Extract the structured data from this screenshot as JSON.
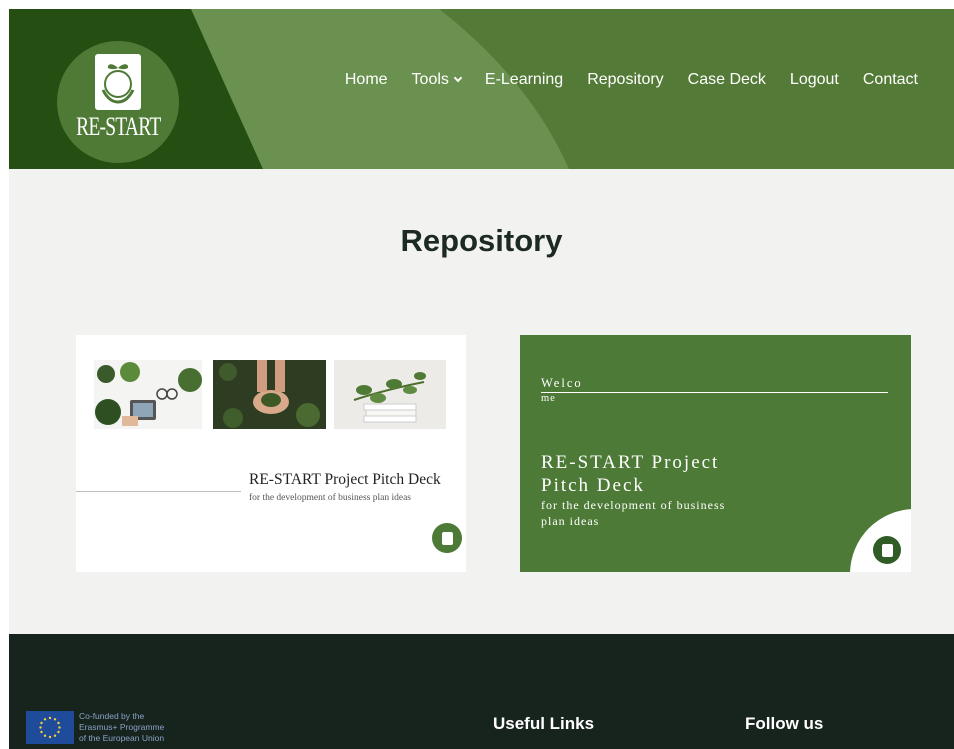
{
  "header": {
    "logo_text": "RE-START",
    "nav": {
      "home": "Home",
      "tools": "Tools",
      "elearning": "E-Learning",
      "repository": "Repository",
      "case_deck": "Case Deck",
      "logout": "Logout",
      "contact": "Contact"
    }
  },
  "main": {
    "title": "Repository",
    "card1": {
      "title": "RE-START Project Pitch Deck",
      "subtitle": "for the development of business plan ideas"
    },
    "card2": {
      "welcome_line1": "Welco",
      "welcome_line2": "me",
      "title_line1": "RE-START Project",
      "title_line2": "Pitch Deck",
      "subtitle_line1": "for the development of business",
      "subtitle_line2": "plan ideas"
    }
  },
  "footer": {
    "eu_text": [
      "Co-funded by the",
      "Erasmus+ Programme",
      "of the European Union"
    ],
    "useful_links": "Useful Links",
    "follow_us": "Follow us"
  },
  "colors": {
    "header_green": "#537a36",
    "dark_green": "#244e12",
    "card_green": "#4d7a36",
    "footer_dark": "#17241d",
    "page_bg": "#f2f3f1"
  },
  "icons": [
    "restart-logo-icon",
    "chevron-down-icon",
    "eu-flag-icon"
  ]
}
